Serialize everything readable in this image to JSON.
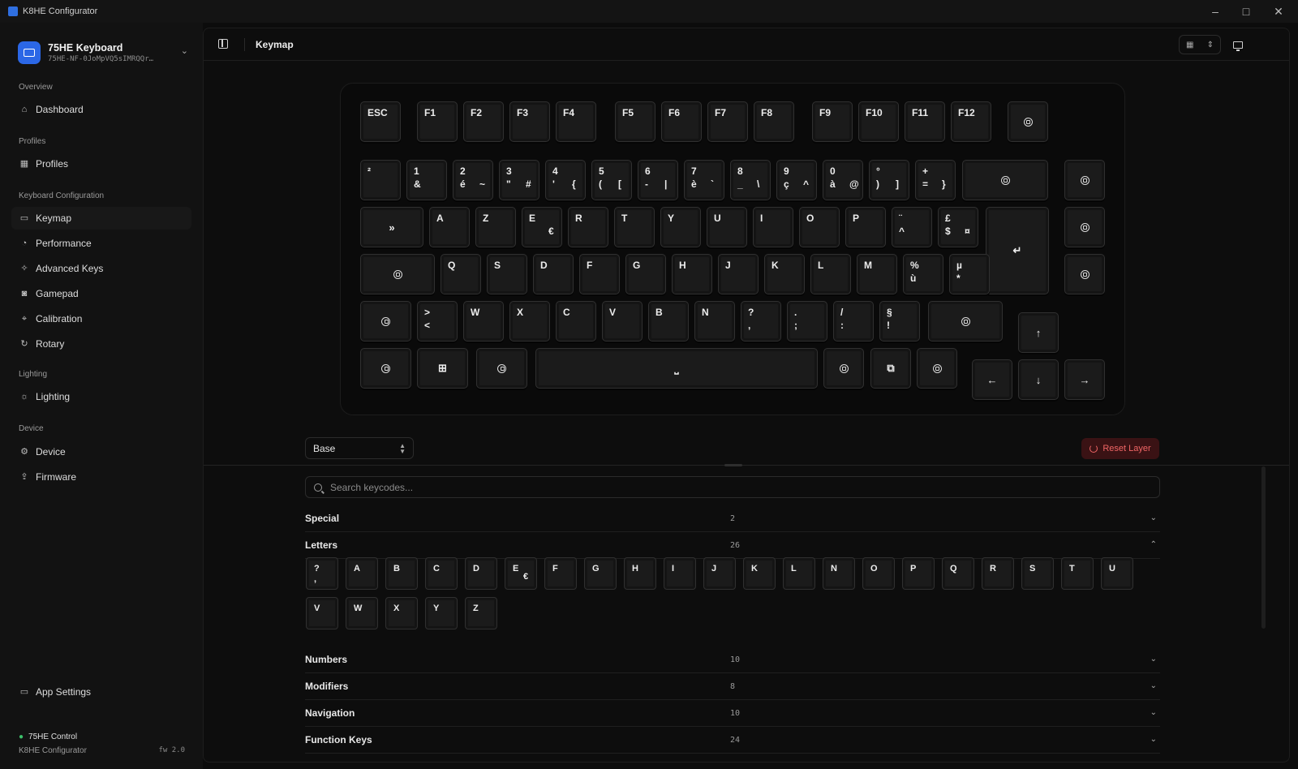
{
  "app": {
    "title": "K8HE Configurator"
  },
  "device": {
    "name": "75HE Keyboard",
    "serial": "75HE-NF-0JoMpVQ5sIMRQQr…"
  },
  "sidebar": {
    "sections": [
      "Overview",
      "Profiles",
      "Keyboard Configuration",
      "Lighting",
      "Device"
    ],
    "items": [
      {
        "label": "Dashboard",
        "icon": "home-icon"
      },
      {
        "label": "Profiles",
        "icon": "grid-icon"
      },
      {
        "label": "Keymap",
        "icon": "keyboard-icon"
      },
      {
        "label": "Performance",
        "icon": "gauge-icon"
      },
      {
        "label": "Advanced Keys",
        "icon": "star-icon"
      },
      {
        "label": "Gamepad",
        "icon": "gamepad-icon"
      },
      {
        "label": "Calibration",
        "icon": "crosshair-icon"
      },
      {
        "label": "Rotary",
        "icon": "rotate-icon"
      },
      {
        "label": "Lighting",
        "icon": "sun-icon"
      },
      {
        "label": "Device",
        "icon": "cog-icon"
      },
      {
        "label": "Firmware",
        "icon": "upload-icon"
      }
    ],
    "footer": {
      "settings": "App Settings",
      "status": "75HE Control",
      "app": "K8HE Configurator",
      "fw": "fw 2.0"
    }
  },
  "header": {
    "title": "Keymap"
  },
  "keyboard": {
    "fn_row": [
      {
        "t": "ESC"
      },
      {
        "t": "F1"
      },
      {
        "t": "F2"
      },
      {
        "t": "F3"
      },
      {
        "t": "F4"
      },
      {
        "t": "F5"
      },
      {
        "t": "F6"
      },
      {
        "t": "F7"
      },
      {
        "t": "F8"
      },
      {
        "t": "F9"
      },
      {
        "t": "F10"
      },
      {
        "t": "F11"
      },
      {
        "t": "F12"
      },
      {
        "icon": "rotary-knob-icon"
      }
    ],
    "num_row": [
      {
        "t": "²"
      },
      {
        "t": "1",
        "b": "&"
      },
      {
        "t": "2",
        "b": "é",
        "b2": "~"
      },
      {
        "t": "3",
        "b": "\"",
        "b2": "#"
      },
      {
        "t": "4",
        "b": "'",
        "b2": "{"
      },
      {
        "t": "5",
        "b": "(",
        "b2": "["
      },
      {
        "t": "6",
        "b": "-",
        "b2": "|"
      },
      {
        "t": "7",
        "b": "è",
        "b2": "`"
      },
      {
        "t": "8",
        "b": "_",
        "b2": "\\"
      },
      {
        "t": "9",
        "b": "ç",
        "b2": "^"
      },
      {
        "t": "0",
        "b": "à",
        "b2": "@"
      },
      {
        "t": "°",
        "b": ")",
        "b2": "]"
      },
      {
        "t": "+",
        "b": "=",
        "b2": "}"
      },
      {
        "icon": "backspace-icon"
      },
      {
        "icon": "page-up-icon"
      }
    ],
    "row_a": [
      {
        "c": "»"
      },
      {
        "t": "A"
      },
      {
        "t": "Z"
      },
      {
        "t": "E",
        "b2": "€"
      },
      {
        "t": "R"
      },
      {
        "t": "T"
      },
      {
        "t": "Y"
      },
      {
        "t": "U"
      },
      {
        "t": "I"
      },
      {
        "t": "O"
      },
      {
        "t": "P"
      },
      {
        "t": "¨",
        "b": "^"
      },
      {
        "t": "£",
        "b": "$",
        "b2": "¤"
      },
      {
        "c": "↵"
      },
      {
        "icon": "page-down-icon"
      }
    ],
    "row_q": [
      {
        "icon": "caps-lock-icon"
      },
      {
        "t": "Q"
      },
      {
        "t": "S"
      },
      {
        "t": "D"
      },
      {
        "t": "F"
      },
      {
        "t": "G"
      },
      {
        "t": "H"
      },
      {
        "t": "J"
      },
      {
        "t": "K"
      },
      {
        "t": "L"
      },
      {
        "t": "M"
      },
      {
        "t": "%",
        "b": "ù"
      },
      {
        "t": "µ",
        "b": "*"
      },
      {
        "icon": "screen-icon"
      }
    ],
    "row_w": [
      {
        "icon": "shift-icon"
      },
      {
        "t": ">",
        "b": "<"
      },
      {
        "t": "W"
      },
      {
        "t": "X"
      },
      {
        "t": "C"
      },
      {
        "t": "V"
      },
      {
        "t": "B"
      },
      {
        "t": "N"
      },
      {
        "t": "?",
        "b": ","
      },
      {
        "t": ".",
        "b": ";"
      },
      {
        "t": "/",
        "b": ":"
      },
      {
        "t": "§",
        "b": "!"
      },
      {
        "icon": "shift-icon"
      }
    ],
    "bottom": [
      {
        "icon": "ctrl-icon"
      },
      {
        "c": "⊞"
      },
      {
        "icon": "alt-icon"
      },
      {
        "c": "⎵"
      },
      {
        "icon": "altgr-icon"
      },
      {
        "c": "⧉"
      },
      {
        "icon": "ctrl-icon"
      }
    ],
    "arrows": [
      {
        "c": "↑"
      },
      {
        "c": "←"
      },
      {
        "c": "↓"
      },
      {
        "c": "→"
      }
    ]
  },
  "layer": {
    "selected": "Base"
  },
  "reset_label": "Reset Layer",
  "search": {
    "placeholder": "Search keycodes..."
  },
  "categories": [
    {
      "name": "Special",
      "count": "2"
    },
    {
      "name": "Letters",
      "count": "26"
    },
    {
      "name": "Numbers",
      "count": "10"
    },
    {
      "name": "Modifiers",
      "count": "8"
    },
    {
      "name": "Navigation",
      "count": "10"
    },
    {
      "name": "Function Keys",
      "count": "24"
    }
  ],
  "letters": [
    {
      "t": "?",
      "b": ","
    },
    {
      "t": "A"
    },
    {
      "t": "B"
    },
    {
      "t": "C"
    },
    {
      "t": "D"
    },
    {
      "t": "E",
      "b2": "€"
    },
    {
      "t": "F"
    },
    {
      "t": "G"
    },
    {
      "t": "H"
    },
    {
      "t": "I"
    },
    {
      "t": "J"
    },
    {
      "t": "K"
    },
    {
      "t": "L"
    },
    {
      "t": "N"
    },
    {
      "t": "O"
    },
    {
      "t": "P"
    },
    {
      "t": "Q"
    },
    {
      "t": "R"
    },
    {
      "t": "S"
    },
    {
      "t": "T"
    },
    {
      "t": "U"
    },
    {
      "t": "V"
    },
    {
      "t": "W"
    },
    {
      "t": "X"
    },
    {
      "t": "Y"
    },
    {
      "t": "Z"
    }
  ],
  "colors": {
    "accent": "#2b67e6",
    "danger": "#f06565",
    "status": "#3cc06a"
  }
}
